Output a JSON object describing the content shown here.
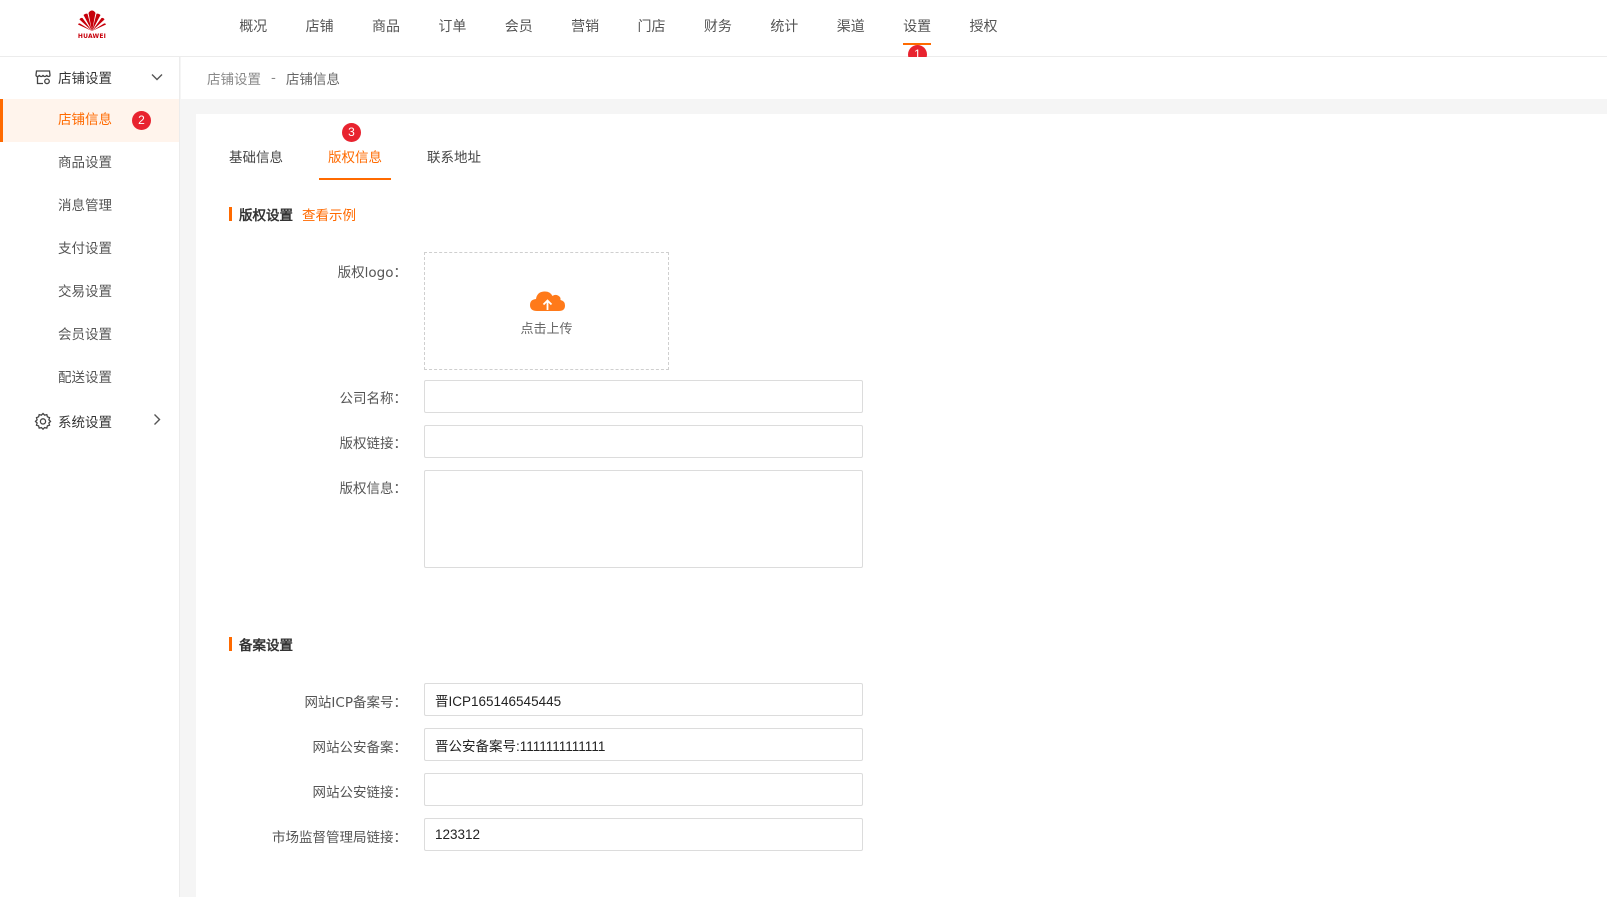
{
  "brand": {
    "logo_text": "HUAWEI",
    "logo_color": "#c7000b"
  },
  "colors": {
    "accent": "#ff6a00",
    "badge": "#e8232f"
  },
  "topnav": {
    "items": [
      {
        "label": "概况"
      },
      {
        "label": "店铺"
      },
      {
        "label": "商品"
      },
      {
        "label": "订单"
      },
      {
        "label": "会员"
      },
      {
        "label": "营销"
      },
      {
        "label": "门店"
      },
      {
        "label": "财务"
      },
      {
        "label": "统计"
      },
      {
        "label": "渠道"
      },
      {
        "label": "设置",
        "active": true,
        "badge": "1"
      },
      {
        "label": "授权"
      }
    ]
  },
  "sidebar": {
    "group1": {
      "label": "店铺设置",
      "icon": "store-icon",
      "expanded": true
    },
    "items": [
      {
        "label": "店铺信息",
        "active": true,
        "badge": "2"
      },
      {
        "label": "商品设置"
      },
      {
        "label": "消息管理"
      },
      {
        "label": "支付设置"
      },
      {
        "label": "交易设置"
      },
      {
        "label": "会员设置"
      },
      {
        "label": "配送设置"
      }
    ],
    "group2": {
      "label": "系统设置",
      "icon": "gear-icon",
      "expanded": false
    }
  },
  "breadcrumb": {
    "parent": "店铺设置",
    "separator": "-",
    "current": "店铺信息"
  },
  "tabs": [
    {
      "label": "基础信息"
    },
    {
      "label": "版权信息",
      "active": true,
      "badge": "3"
    },
    {
      "label": "联系地址"
    }
  ],
  "copyright": {
    "title": "版权设置",
    "example_link": "查看示例",
    "logo_label": "版权logo：",
    "upload_text": "点击上传",
    "company_label": "公司名称：",
    "company_value": "",
    "link_label": "版权链接：",
    "link_value": "",
    "info_label": "版权信息：",
    "info_value": ""
  },
  "record": {
    "title": "备案设置",
    "icp_label": "网站ICP备案号：",
    "icp_value": "晋ICP165146545445",
    "police_label": "网站公安备案：",
    "police_value": "晋公安备案号:1111111111111",
    "police_link_label": "网站公安链接：",
    "police_link_value": "",
    "market_label": "市场监督管理局链接：",
    "market_value": "123312"
  }
}
